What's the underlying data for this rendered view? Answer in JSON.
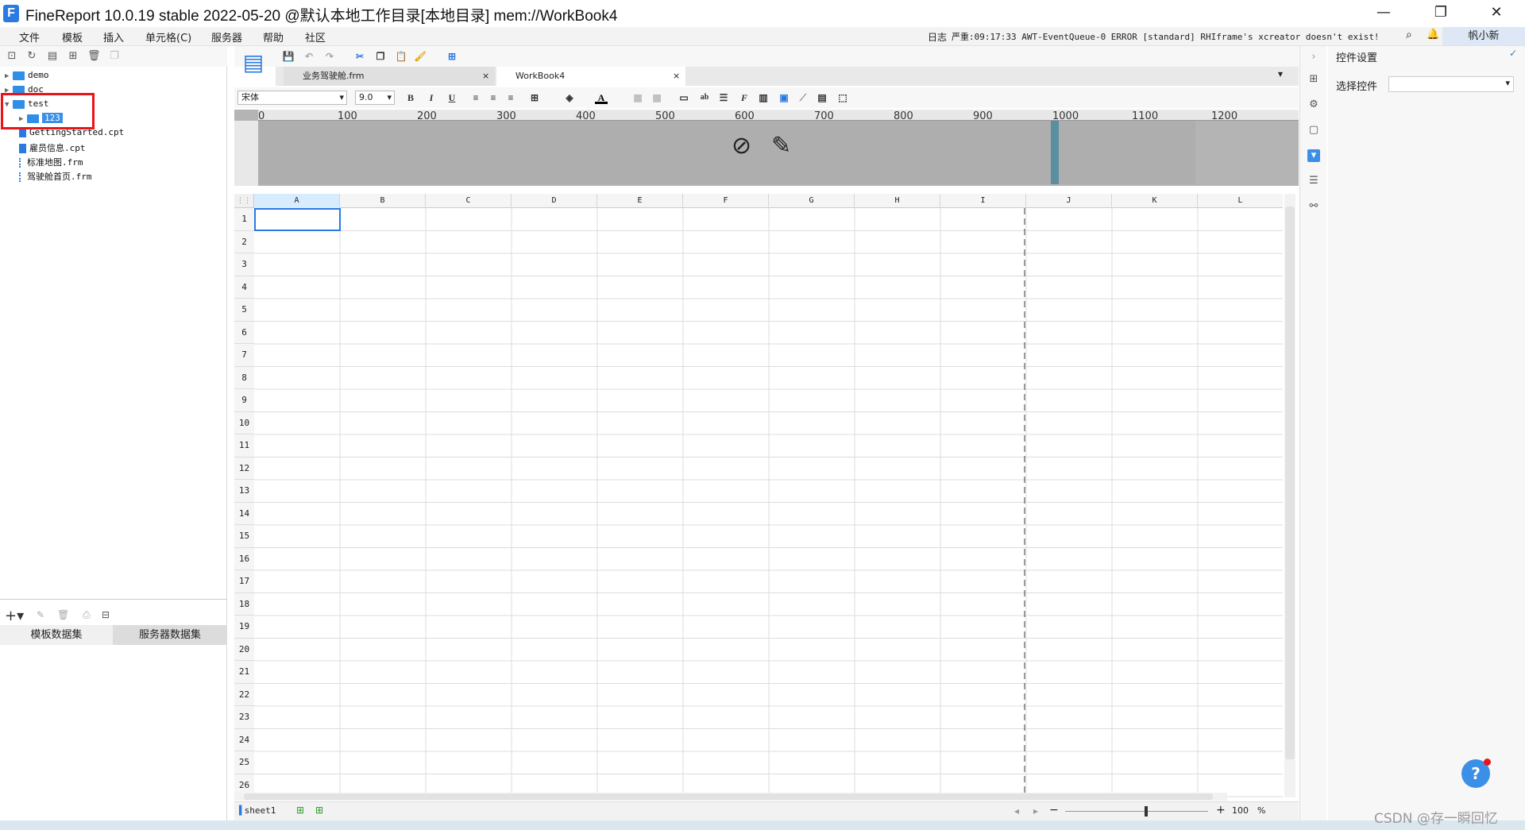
{
  "window": {
    "title": "FineReport 10.0.19 stable 2022-05-20 @默认本地工作目录[本地目录]    mem://WorkBook4",
    "minimize": "—",
    "restore": "❐",
    "close": "✕"
  },
  "menubar": {
    "items": [
      "文件",
      "模板",
      "插入",
      "单元格(C)",
      "服务器",
      "帮助",
      "社区"
    ],
    "log_label": "日志",
    "log_message": "严重:09:17:33 AWT-EventQueue-0 ERROR [standard] RHIframe's xcreator doesn't exist!",
    "user": "帆小新"
  },
  "file_tree": {
    "items": [
      {
        "name": "demo",
        "type": "folder",
        "expanded": false
      },
      {
        "name": "doc",
        "type": "folder",
        "expanded": false
      },
      {
        "name": "test",
        "type": "folder",
        "expanded": true
      },
      {
        "name": "123",
        "type": "folder",
        "expanded": false,
        "selected": true
      },
      {
        "name": "GettingStarted.cpt",
        "type": "cpt"
      },
      {
        "name": "雇员信息.cpt",
        "type": "cpt"
      },
      {
        "name": "标准地图.frm",
        "type": "frm"
      },
      {
        "name": "驾驶舱首页.frm",
        "type": "frm"
      }
    ]
  },
  "dataset": {
    "tabs": [
      "模板数据集",
      "服务器数据集"
    ],
    "active_tab": 0
  },
  "editor": {
    "tabs": [
      {
        "label": "业务驾驶舱.frm"
      },
      {
        "label": "WorkBook4"
      }
    ],
    "font_name": "宋体",
    "font_size": "9.0",
    "ruler_ticks": [
      "0",
      "100",
      "200",
      "300",
      "400",
      "500",
      "600",
      "700",
      "800",
      "900",
      "1000",
      "1100",
      "1200"
    ],
    "columns": [
      "A",
      "B",
      "C",
      "D",
      "E",
      "F",
      "G",
      "H",
      "I",
      "J",
      "K",
      "L"
    ],
    "rows": [
      "1",
      "2",
      "3",
      "4",
      "5",
      "6",
      "7",
      "8",
      "9",
      "10",
      "11",
      "12",
      "13",
      "14",
      "15",
      "16",
      "17",
      "18",
      "19",
      "20",
      "21",
      "22",
      "23",
      "24",
      "25",
      "26"
    ],
    "selected_cell": "A1",
    "sheet_tab": "sheet1",
    "zoom": "100",
    "zoom_unit": "%"
  },
  "properties": {
    "title": "控件设置",
    "select_control_label": "选择控件",
    "select_control_value": ""
  },
  "overlay": {
    "help_icon": "?",
    "watermark": "CSDN @存一瞬回忆"
  },
  "colors": {
    "accent": "#2a7ae2",
    "highlight_box": "#e8141c",
    "selected_folder_bg": "#3b8fe6"
  }
}
